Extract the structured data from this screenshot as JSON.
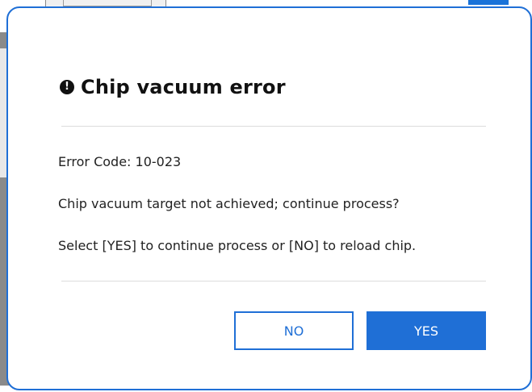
{
  "dialog": {
    "title": "Chip vacuum error",
    "icon": "exclamation-circle-icon",
    "error_code": "Error Code: 10-023",
    "question": "Chip vacuum target not achieved; continue process?",
    "instruction": "Select [YES] to continue process or [NO] to reload chip.",
    "buttons": {
      "no_label": "NO",
      "yes_label": "YES"
    },
    "colors": {
      "accent": "#1f6fd6",
      "text": "#222222",
      "divider": "#dcdcdc"
    }
  }
}
